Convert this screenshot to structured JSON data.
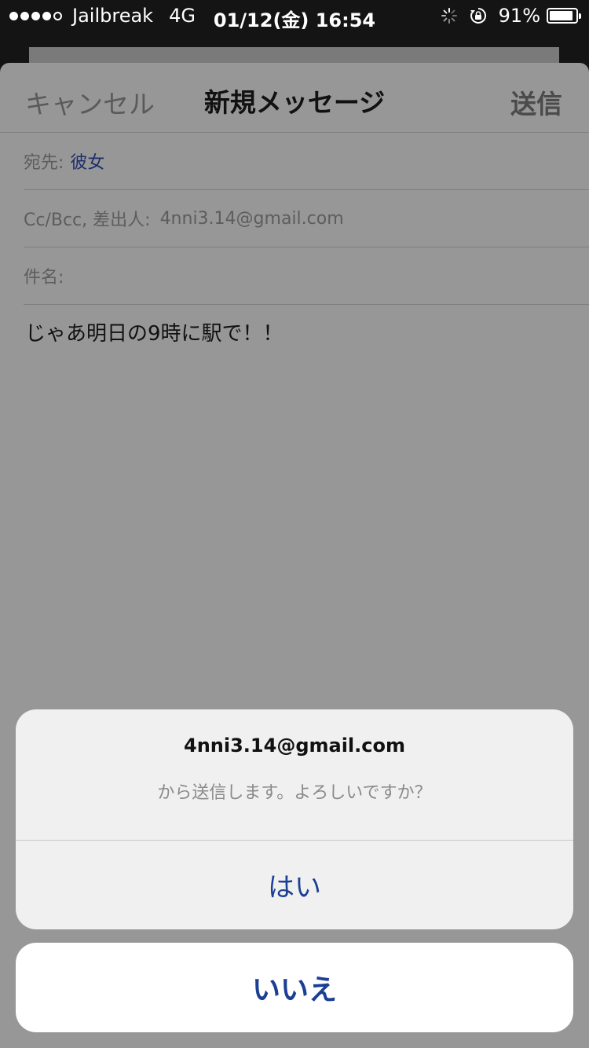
{
  "status_bar": {
    "carrier": "Jailbreak",
    "network": "4G",
    "datetime": "01/12(金) 16:54",
    "battery_percent": "91%",
    "battery_level": 0.91,
    "signal_bars_filled": 4,
    "signal_bars_total": 5
  },
  "compose": {
    "cancel_label": "キャンセル",
    "title": "新規メッセージ",
    "send_label": "送信",
    "to_label": "宛先:",
    "to_value": "彼女",
    "cc_label": "Cc/Bcc, 差出人:",
    "cc_value": "4nni3.14@gmail.com",
    "subject_label": "件名:",
    "subject_value": "",
    "body": "じゃあ明日の9時に駅で！！"
  },
  "alert": {
    "title": "4nni3.14@gmail.com",
    "message": "から送信します。よろしいですか？",
    "yes_label": "はい",
    "no_label": "いいえ"
  },
  "colors": {
    "accent_blue": "#1b3f95",
    "dimmed_background": "#979797"
  }
}
